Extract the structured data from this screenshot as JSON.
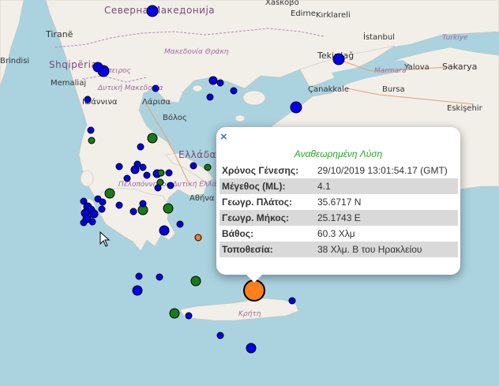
{
  "map": {
    "labels": {
      "cities": [
        "Tiranë",
        "Tekirdağ",
        "Edirne",
        "Kırklareli",
        "İstanbul",
        "Yalova",
        "Sakarya",
        "Bursa",
        "Eskişehir",
        "Çanakkale",
        "Λάρισα",
        "Βόλος",
        "Ιωάννινα",
        "Αθήνα",
        "Memaliaj",
        "Brindisi",
        "Xásκοβο"
      ],
      "countries": [
        "Северна Македонија",
        "Shqipëria",
        "Ελλάδα"
      ],
      "regions": [
        "Ήπειρος",
        "Δυτική Μακεδονία",
        "Μακεδονία Θράκη",
        "Πελοπόννησος Δυτική Ελλάδα",
        "Κρήτη",
        "Marmara",
        "Turkiye"
      ],
      "seas": []
    },
    "events": [
      {
        "color": "blue",
        "size": "large",
        "label": ""
      },
      {
        "color": "green",
        "size": "small",
        "label": ""
      },
      {
        "color": "orange",
        "size": "small",
        "label": ""
      },
      {
        "color": "orange",
        "size": "large",
        "label": "selected"
      }
    ]
  },
  "popup": {
    "close_label": "×",
    "heading": "Αναθεωρημένη Λύση",
    "rows": [
      {
        "key": "Χρόνος Γένεσης:",
        "value": "29/10/2019 13:01:54.17 (GMT)"
      },
      {
        "key": "Μέγεθος (ML):",
        "value": "4.1"
      },
      {
        "key": "Γεωγρ. Πλάτος:",
        "value": "35.6717 N"
      },
      {
        "key": "Γεωγρ. Μήκος:",
        "value": "25.1743 E"
      },
      {
        "key": "Βάθος:",
        "value": "60.3 Χλμ"
      },
      {
        "key": "Τοποθεσία:",
        "value": "38 Χλμ. Β του Ηρακλείου"
      }
    ]
  },
  "colors": {
    "sea": "#aad3df",
    "land": "#f2efe9",
    "event_blue": "#0000ee",
    "event_green": "#1a7a1a",
    "event_orange": "#ff7f1a",
    "heading": "#22aa22",
    "close": "#3b7bbf"
  },
  "icons": [
    "close-icon",
    "cursor-arrow-icon"
  ]
}
